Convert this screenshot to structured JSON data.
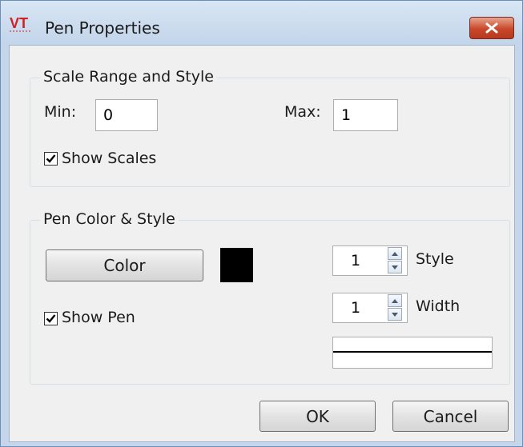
{
  "window": {
    "title": "Pen Properties",
    "icon": "vt-app-icon",
    "icon_text": "VT",
    "close_icon": "close-icon"
  },
  "scale_group": {
    "label": "Scale Range and Style",
    "min_label": "Min:",
    "min_value": "0",
    "max_label": "Max:",
    "max_value": "1",
    "show_scales_label": "Show Scales",
    "show_scales_checked": true
  },
  "pen_group": {
    "label": "Pen Color & Style",
    "color_button": "Color",
    "color_swatch": "#000000",
    "show_pen_label": "Show Pen",
    "show_pen_checked": true,
    "style_value": "1",
    "style_label": "Style",
    "width_value": "1",
    "width_label": "Width"
  },
  "buttons": {
    "ok": "OK",
    "cancel": "Cancel"
  }
}
